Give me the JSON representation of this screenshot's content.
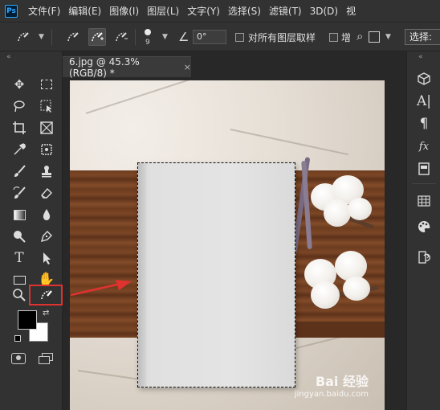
{
  "menubar": {
    "logo": "Ps",
    "items": [
      "文件(F)",
      "编辑(E)",
      "图像(I)",
      "图层(L)",
      "文字(Y)",
      "选择(S)",
      "滤镜(T)",
      "3D(D)",
      "视"
    ]
  },
  "options": {
    "brush_size": "9",
    "angle_value": "0°",
    "sample_all_layers_label": "对所有图层取样",
    "enhance_label": "增",
    "select_label": "选择:"
  },
  "document": {
    "tab_title": "6.jpg @ 45.3%(RGB/8) *",
    "close_glyph": "×"
  },
  "watermark": {
    "main": "Bai 经验",
    "sub": "jingyan.baidu.com"
  },
  "colors": {
    "highlight": "#e0322f",
    "accent": "#31a8ff",
    "foreground_swatch": "#000000",
    "background_swatch": "#ffffff"
  },
  "icons": {
    "toolbar_left": [
      "move-icon",
      "marquee-icon",
      "lasso-icon",
      "object-select-icon",
      "crop-icon",
      "frame-icon",
      "eyedropper-icon",
      "patch-icon",
      "brush-icon",
      "stamp-icon",
      "history-brush-icon",
      "eraser-icon",
      "gradient-icon",
      "blur-icon",
      "dodge-icon",
      "pen-icon",
      "type-icon",
      "path-select-icon",
      "rectangle-icon",
      "hand-icon",
      "zoom-icon",
      "quick-select-icon"
    ],
    "toolbar_right": [
      "3d-icon",
      "character-icon",
      "paragraph-icon",
      "glyphs-icon",
      "libraries-icon",
      "swatches-icon",
      "color-icon",
      "history-icon"
    ]
  }
}
